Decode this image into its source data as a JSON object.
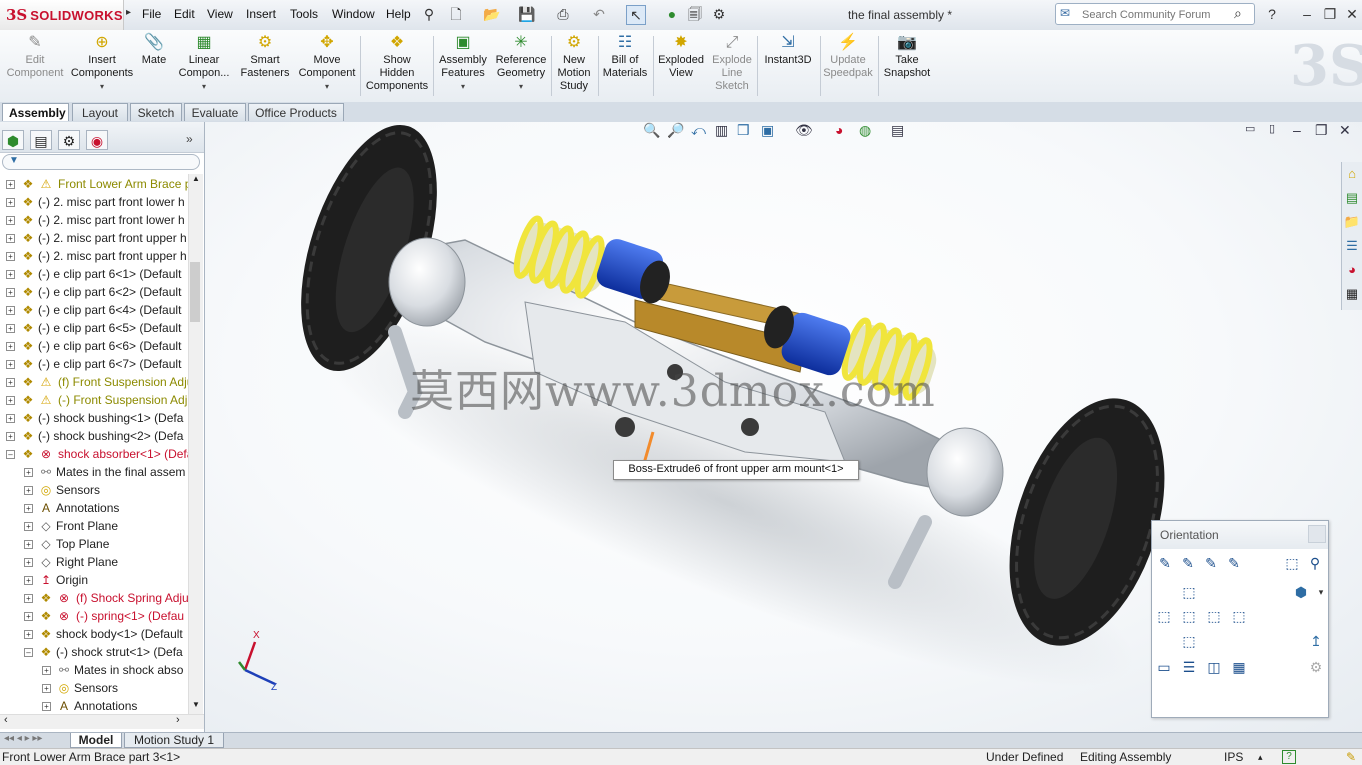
{
  "app": {
    "brand_ds": "3S",
    "brand_name": "SOLIDWORKS",
    "title": "the final assembly *"
  },
  "menu": [
    "File",
    "Edit",
    "View",
    "Insert",
    "Tools",
    "Window",
    "Help"
  ],
  "search": {
    "placeholder": "Search Community Forum"
  },
  "commands": [
    {
      "label": "Edit\nComponent",
      "icon": "edit-component-icon",
      "enabled": false
    },
    {
      "label": "Insert\nComponents",
      "icon": "insert-components-icon",
      "enabled": true
    },
    {
      "label": "Mate",
      "icon": "mate-icon",
      "enabled": true
    },
    {
      "label": "Linear\nCompon...",
      "icon": "linear-pattern-icon",
      "enabled": true
    },
    {
      "label": "Smart\nFasteners",
      "icon": "smart-fasteners-icon",
      "enabled": true
    },
    {
      "label": "Move\nComponent",
      "icon": "move-component-icon",
      "enabled": true
    },
    {
      "label": "Show\nHidden\nComponents",
      "icon": "show-hidden-icon",
      "enabled": true
    },
    {
      "label": "Assembly\nFeatures",
      "icon": "assembly-features-icon",
      "enabled": true
    },
    {
      "label": "Reference\nGeometry",
      "icon": "reference-geometry-icon",
      "enabled": true
    },
    {
      "label": "New\nMotion\nStudy",
      "icon": "motion-study-icon",
      "enabled": true
    },
    {
      "label": "Bill of\nMaterials",
      "icon": "bom-icon",
      "enabled": true
    },
    {
      "label": "Exploded\nView",
      "icon": "exploded-view-icon",
      "enabled": true
    },
    {
      "label": "Explode\nLine\nSketch",
      "icon": "explode-line-icon",
      "enabled": false
    },
    {
      "label": "Instant3D",
      "icon": "instant3d-icon",
      "enabled": true
    },
    {
      "label": "Update\nSpeedpak",
      "icon": "speedpak-icon",
      "enabled": false
    },
    {
      "label": "Take\nSnapshot",
      "icon": "snapshot-icon",
      "enabled": true
    }
  ],
  "command_tabs": [
    "Assembly",
    "Layout",
    "Sketch",
    "Evaluate",
    "Office Products"
  ],
  "tree": [
    {
      "label": "Front Lower Arm Brace p",
      "state": "warn",
      "indent": 0
    },
    {
      "label": "(-) 2. misc part front lower h",
      "state": "",
      "indent": 0
    },
    {
      "label": "(-) 2. misc part front lower h",
      "state": "",
      "indent": 0
    },
    {
      "label": "(-) 2. misc part front upper h",
      "state": "",
      "indent": 0
    },
    {
      "label": "(-) 2. misc part front upper h",
      "state": "",
      "indent": 0
    },
    {
      "label": "(-) e clip part 6<1> (Default",
      "state": "",
      "indent": 0
    },
    {
      "label": "(-) e clip part 6<2> (Default",
      "state": "",
      "indent": 0
    },
    {
      "label": "(-) e clip part 6<4> (Default",
      "state": "",
      "indent": 0
    },
    {
      "label": "(-) e clip part 6<5> (Default",
      "state": "",
      "indent": 0
    },
    {
      "label": "(-) e clip part 6<6> (Default",
      "state": "",
      "indent": 0
    },
    {
      "label": "(-) e clip part 6<7> (Default",
      "state": "",
      "indent": 0
    },
    {
      "label": "(f) Front Suspension Adju",
      "state": "warn",
      "indent": 0
    },
    {
      "label": "(-) Front Suspension Adju",
      "state": "warn",
      "indent": 0
    },
    {
      "label": "(-) shock bushing<1> (Defa",
      "state": "",
      "indent": 0
    },
    {
      "label": "(-) shock bushing<2> (Defa",
      "state": "",
      "indent": 0
    },
    {
      "label": "shock absorber<1> (Defa",
      "state": "err",
      "indent": 0
    },
    {
      "label": "Mates in the final assem",
      "state": "mates",
      "indent": 1
    },
    {
      "label": "Sensors",
      "state": "sensors",
      "indent": 1
    },
    {
      "label": "Annotations",
      "state": "annot",
      "indent": 1
    },
    {
      "label": "Front Plane",
      "state": "plane",
      "indent": 1
    },
    {
      "label": "Top Plane",
      "state": "plane",
      "indent": 1
    },
    {
      "label": "Right Plane",
      "state": "plane",
      "indent": 1
    },
    {
      "label": "Origin",
      "state": "origin",
      "indent": 1
    },
    {
      "label": "(f) Shock Spring Adju",
      "state": "err",
      "indent": 1
    },
    {
      "label": "(-) spring<1> (Defau",
      "state": "err",
      "indent": 1
    },
    {
      "label": "shock body<1> (Default",
      "state": "",
      "indent": 1
    },
    {
      "label": "(-) shock strut<1> (Defa",
      "state": "",
      "indent": 1
    },
    {
      "label": "Mates in shock abso",
      "state": "mates",
      "indent": 2
    },
    {
      "label": "Sensors",
      "state": "sensors",
      "indent": 2
    },
    {
      "label": "Annotations",
      "state": "annot",
      "indent": 2
    }
  ],
  "graphics": {
    "tooltip": "Boss-Extrude6 of front upper arm mount<1>",
    "watermark": "莫西网www.3dmox.com",
    "triad": {
      "x": "X",
      "z": "Z"
    }
  },
  "orientation": {
    "title": "Orientation",
    "top_icons": [
      "view-orient-icon-1",
      "view-orient-icon-2",
      "view-orient-icon-3",
      "view-orient-icon-4"
    ],
    "views": [
      "top-view-icon",
      "left-view-icon",
      "front-view-icon",
      "right-view-icon",
      "back-view-icon",
      "bottom-view-icon"
    ]
  },
  "bottom_tabs": [
    "Model",
    "Motion Study 1"
  ],
  "status": {
    "left": "Front Lower Arm Brace part 3<1>",
    "state": "Under Defined",
    "mode": "Editing Assembly",
    "units": "IPS",
    "help": "?"
  },
  "colors": {
    "brand_red": "#c8102e",
    "warn_text": "#8c8a00",
    "error_text": "#c8102e",
    "tire": "#1e1e1e",
    "spring": "#f0e53c",
    "shock_body": "#1d4fd6",
    "brace": "#c89b3b"
  }
}
